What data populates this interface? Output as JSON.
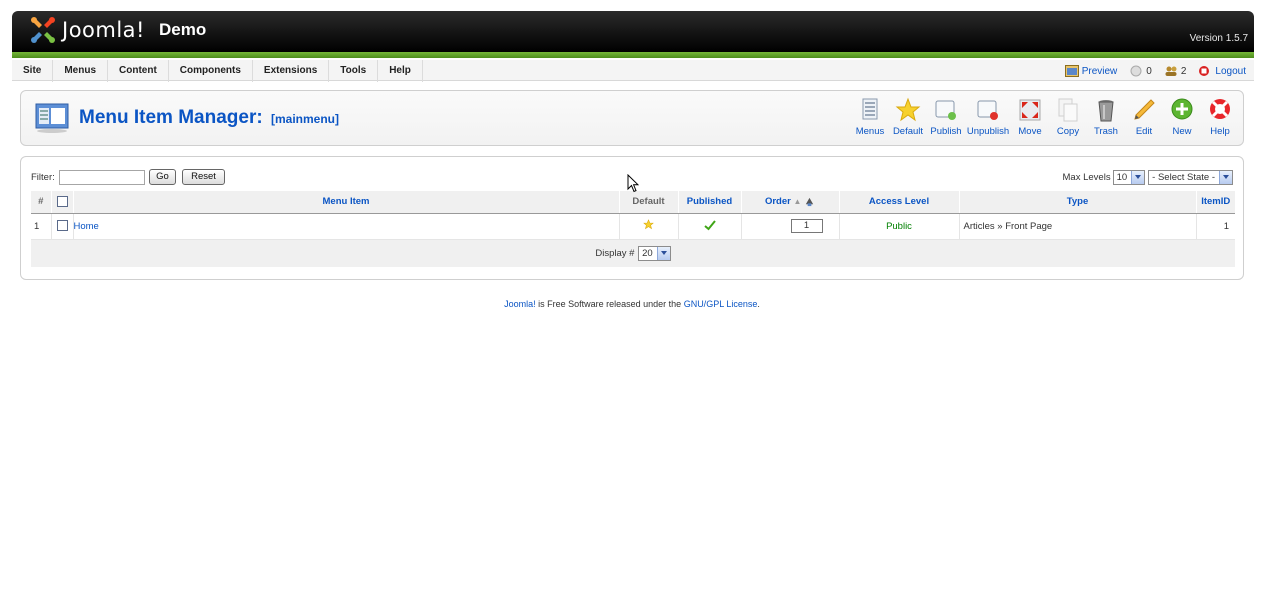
{
  "header": {
    "logo_text": "Joomla!",
    "site_name": "Demo",
    "version": "Version 1.5.7"
  },
  "menu": {
    "items": [
      "Site",
      "Menus",
      "Content",
      "Components",
      "Extensions",
      "Tools",
      "Help"
    ]
  },
  "status": {
    "preview": "Preview",
    "messages": "0",
    "users": "2",
    "logout": "Logout"
  },
  "page": {
    "title": "Menu Item Manager:",
    "subtitle": "[mainmenu]"
  },
  "toolbar": {
    "buttons": [
      "Menus",
      "Default",
      "Publish",
      "Unpublish",
      "Move",
      "Copy",
      "Trash",
      "Edit",
      "New",
      "Help"
    ]
  },
  "filter": {
    "label": "Filter:",
    "value": "",
    "go": "Go",
    "reset": "Reset",
    "max_levels_label": "Max Levels",
    "max_levels_value": "10",
    "state_value": "- Select State -"
  },
  "table": {
    "headers": {
      "num": "#",
      "menu_item": "Menu Item",
      "default": "Default",
      "published": "Published",
      "order": "Order",
      "access": "Access Level",
      "type": "Type",
      "itemid": "ItemID"
    },
    "rows": [
      {
        "num": "1",
        "menu_item": "Home",
        "order": "1",
        "access": "Public",
        "type": "Articles » Front Page",
        "itemid": "1"
      }
    ],
    "display_label": "Display #",
    "display_value": "20"
  },
  "footer": {
    "joomla_link": "Joomla!",
    "text": " is Free Software released under the ",
    "license_link": "GNU/GPL License",
    "end": "."
  },
  "colors": {
    "link": "#0b55c4",
    "header_bg": "#000000",
    "header_strip": "#5ea12a",
    "public": "#008000"
  }
}
